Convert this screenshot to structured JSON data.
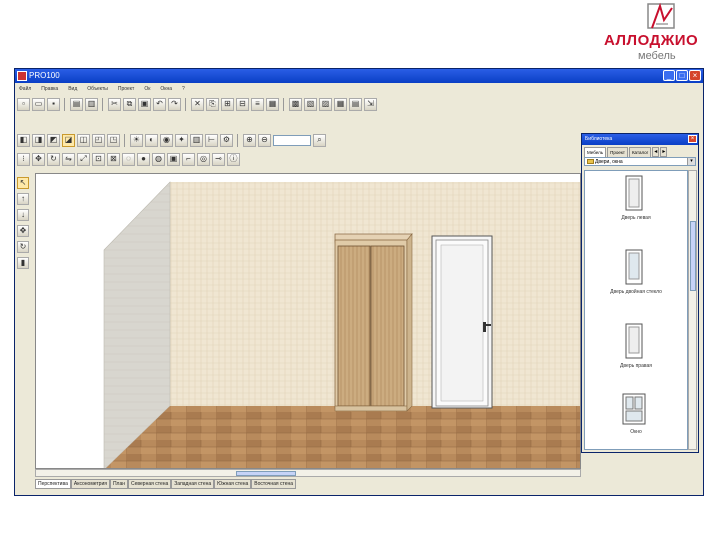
{
  "logo": {
    "brand": "АЛЛОДЖИО",
    "sub": "мебель",
    "brand_color": "#c8102e"
  },
  "window": {
    "title": "PRO100"
  },
  "menu": {
    "items": [
      "Файл",
      "Правка",
      "Вид",
      "Объекты",
      "Проект",
      "Ок",
      "Окна",
      "?"
    ]
  },
  "panel": {
    "title": "Библиотека",
    "tabs": [
      "Мебель",
      "Проект",
      "Каталог"
    ],
    "folder": "Двери, окна",
    "items": [
      {
        "caption": "Дверь левая",
        "icon": "door-left-icon"
      },
      {
        "caption": "Дверь двойная стекло",
        "icon": "door-glass-icon"
      },
      {
        "caption": "Дверь правая",
        "icon": "door-right-icon"
      },
      {
        "caption": "Окно",
        "icon": "window-icon"
      }
    ]
  },
  "view_tabs": [
    {
      "label": "Перспектива",
      "active": true
    },
    {
      "label": "Аксонометрия",
      "active": false
    },
    {
      "label": "План",
      "active": false
    },
    {
      "label": "Северная стена",
      "active": false
    },
    {
      "label": "Западная стена",
      "active": false
    },
    {
      "label": "Южная стена",
      "active": false
    },
    {
      "label": "Восточная стена",
      "active": false
    }
  ],
  "colors": {
    "wall_back": "#f0e6d2",
    "wall_left": "#d8d6cf",
    "floor": "#b88a5c",
    "wardrobe": "#c9a77b",
    "door": "#f6f6f6",
    "accent": "#0a3fc5"
  }
}
